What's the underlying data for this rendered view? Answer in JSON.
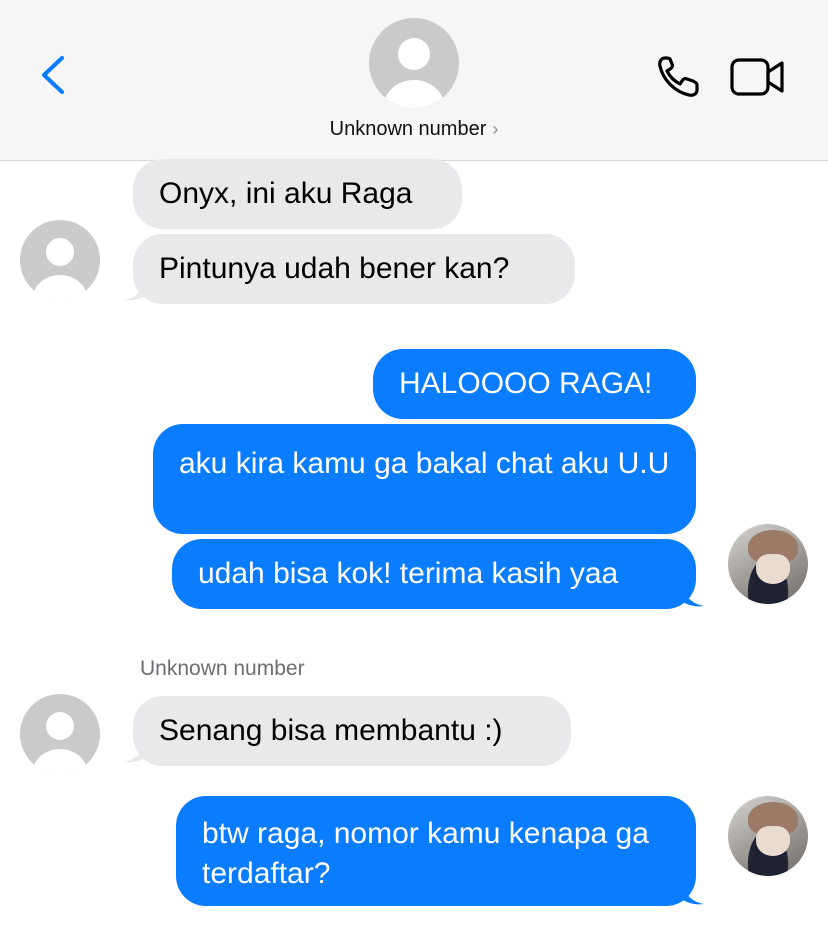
{
  "header": {
    "contact_name": "Unknown number",
    "chevron": "›",
    "icons": {
      "back": "chevron-left-icon",
      "call": "phone-icon",
      "video": "video-camera-icon",
      "avatar": "person-placeholder-icon"
    },
    "accent": "#0a7cff"
  },
  "colors": {
    "incoming_bubble": "#e9e9eb",
    "outgoing_bubble": "#0a7cff",
    "header_bg": "#f6f6f6"
  },
  "messages": [
    {
      "direction": "in",
      "text": "Onyx, ini aku Raga"
    },
    {
      "direction": "in",
      "text": "Pintunya udah bener kan?"
    },
    {
      "direction": "out",
      "text": "HALOOOO RAGA!"
    },
    {
      "direction": "out",
      "text": "aku kira kamu ga bakal chat aku U.U"
    },
    {
      "direction": "out",
      "text": "udah bisa kok! terima kasih yaa"
    },
    {
      "direction": "in",
      "sender": "Unknown number",
      "text": "Senang bisa membantu :)"
    },
    {
      "direction": "out",
      "text": "btw raga, nomor kamu kenapa ga terdaftar?"
    }
  ]
}
